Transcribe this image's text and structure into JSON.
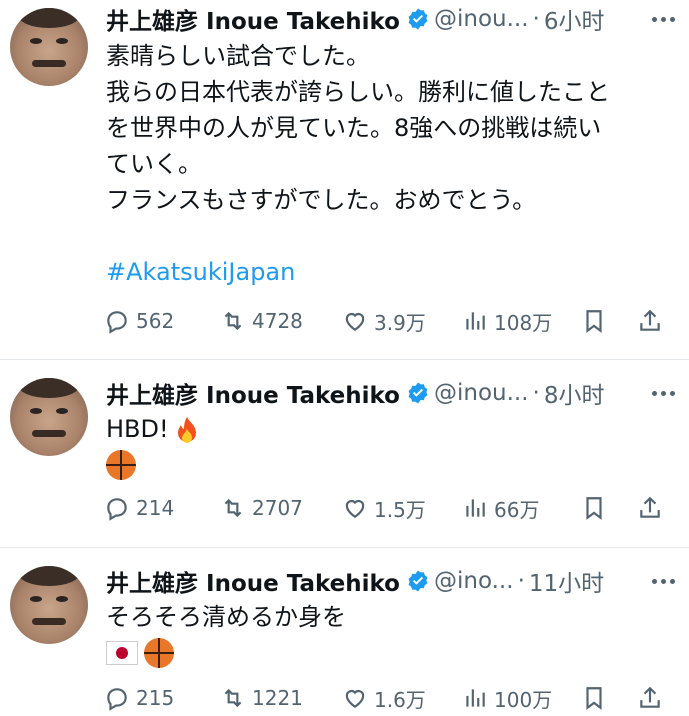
{
  "tweets": [
    {
      "name": "井上雄彦 Inoue Takehiko",
      "handle": "@inou...",
      "dot": "·",
      "time": "6小时",
      "lines": [
        "素晴らしい試合でした。",
        "我らの日本代表が誇らしい。勝利に値したこと",
        "を世界中の人が見ていた。8強への挑戦は続い",
        "ていく。",
        "フランスもさすがでした。おめでとう。"
      ],
      "hashtag": "#AkatsukiJapan",
      "replies": "562",
      "retweets": "4728",
      "likes": "3.9万",
      "views": "108万"
    },
    {
      "name": "井上雄彦 Inoue Takehiko",
      "handle": "@inou...",
      "dot": "·",
      "time": "8小时",
      "text": "HBD!",
      "emoji": [
        "fire-emoji",
        "basketball-emoji"
      ],
      "replies": "214",
      "retweets": "2707",
      "likes": "1.5万",
      "views": "66万"
    },
    {
      "name": "井上雄彦 Inoue Takehiko",
      "handle": "@ino...",
      "dot": "·",
      "time": "11小时",
      "text": "そろそろ清めるか身を",
      "emoji": [
        "japan-flag-emoji",
        "basketball-emoji"
      ],
      "replies": "215",
      "retweets": "1221",
      "likes": "1.6万",
      "views": "100万"
    }
  ],
  "colors": {
    "link": "#1d9bf0",
    "secondary": "#536471",
    "verified": "#1d9bf0",
    "divider": "#e6e9ec"
  },
  "icons": [
    "reply-icon",
    "retweet-icon",
    "like-icon",
    "views-icon",
    "bookmark-icon",
    "share-icon",
    "verified-badge-icon",
    "more-icon"
  ]
}
